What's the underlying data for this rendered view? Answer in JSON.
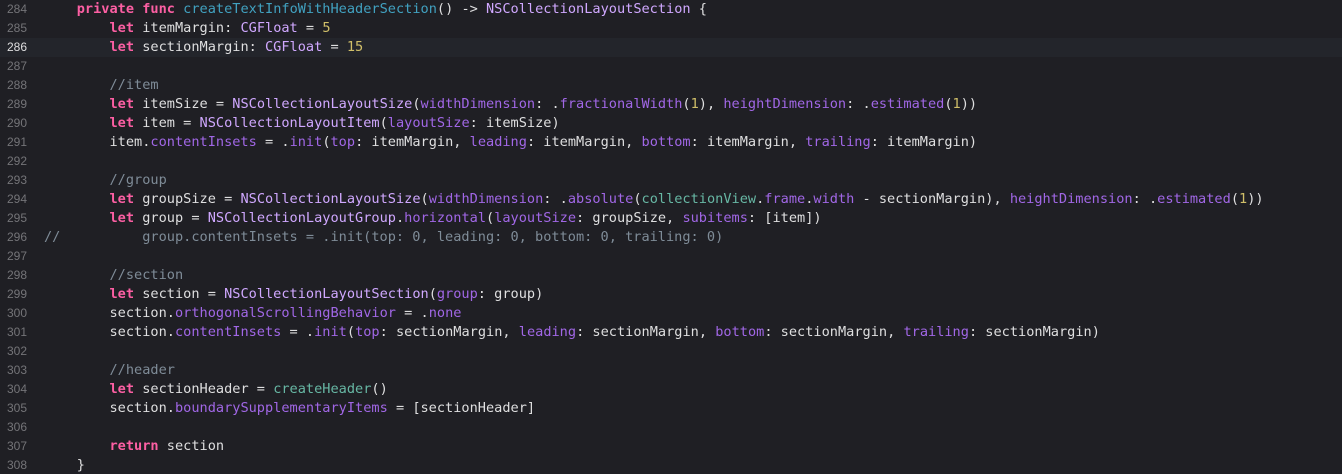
{
  "colors": {
    "background": "#1f1f24",
    "current_line": "#23252b",
    "keyword": "#fc5fa3",
    "declaration": "#41a1c0",
    "type": "#d0a8ff",
    "parameter": "#a167e6",
    "number": "#d0bf69",
    "comment": "#7f8c98",
    "project_symbol": "#67b7a4",
    "plain": "#dfdfe0"
  },
  "editor": {
    "current_line_number": "286",
    "lines": [
      {
        "num": "284",
        "tokens": [
          {
            "t": "    ",
            "c": "plain"
          },
          {
            "t": "private",
            "c": "keyword"
          },
          {
            "t": " ",
            "c": "plain"
          },
          {
            "t": "func",
            "c": "keyword"
          },
          {
            "t": " ",
            "c": "plain"
          },
          {
            "t": "createTextInfoWithHeaderSection",
            "c": "decl"
          },
          {
            "t": "() -> ",
            "c": "plain"
          },
          {
            "t": "NSCollectionLayoutSection",
            "c": "type"
          },
          {
            "t": " {",
            "c": "plain"
          }
        ]
      },
      {
        "num": "285",
        "tokens": [
          {
            "t": "        ",
            "c": "plain"
          },
          {
            "t": "let",
            "c": "keyword"
          },
          {
            "t": " itemMargin: ",
            "c": "plain"
          },
          {
            "t": "CGFloat",
            "c": "type"
          },
          {
            "t": " = ",
            "c": "plain"
          },
          {
            "t": "5",
            "c": "number"
          }
        ]
      },
      {
        "num": "286",
        "tokens": [
          {
            "t": "        ",
            "c": "plain"
          },
          {
            "t": "let",
            "c": "keyword"
          },
          {
            "t": " sectionMargin: ",
            "c": "plain"
          },
          {
            "t": "CGFloat",
            "c": "type"
          },
          {
            "t": " = ",
            "c": "plain"
          },
          {
            "t": "15",
            "c": "number"
          }
        ]
      },
      {
        "num": "287",
        "tokens": []
      },
      {
        "num": "288",
        "tokens": [
          {
            "t": "        ",
            "c": "plain"
          },
          {
            "t": "//item",
            "c": "comment"
          }
        ]
      },
      {
        "num": "289",
        "tokens": [
          {
            "t": "        ",
            "c": "plain"
          },
          {
            "t": "let",
            "c": "keyword"
          },
          {
            "t": " itemSize = ",
            "c": "plain"
          },
          {
            "t": "NSCollectionLayoutSize",
            "c": "type"
          },
          {
            "t": "(",
            "c": "plain"
          },
          {
            "t": "widthDimension",
            "c": "param"
          },
          {
            "t": ": .",
            "c": "plain"
          },
          {
            "t": "fractionalWidth",
            "c": "func"
          },
          {
            "t": "(",
            "c": "plain"
          },
          {
            "t": "1",
            "c": "number"
          },
          {
            "t": "), ",
            "c": "plain"
          },
          {
            "t": "heightDimension",
            "c": "param"
          },
          {
            "t": ": .",
            "c": "plain"
          },
          {
            "t": "estimated",
            "c": "func"
          },
          {
            "t": "(",
            "c": "plain"
          },
          {
            "t": "1",
            "c": "number"
          },
          {
            "t": "))",
            "c": "plain"
          }
        ]
      },
      {
        "num": "290",
        "tokens": [
          {
            "t": "        ",
            "c": "plain"
          },
          {
            "t": "let",
            "c": "keyword"
          },
          {
            "t": " item = ",
            "c": "plain"
          },
          {
            "t": "NSCollectionLayoutItem",
            "c": "type"
          },
          {
            "t": "(",
            "c": "plain"
          },
          {
            "t": "layoutSize",
            "c": "param"
          },
          {
            "t": ": itemSize)",
            "c": "plain"
          }
        ]
      },
      {
        "num": "291",
        "tokens": [
          {
            "t": "        ",
            "c": "plain"
          },
          {
            "t": "item.",
            "c": "plain"
          },
          {
            "t": "contentInsets",
            "c": "func"
          },
          {
            "t": " = .",
            "c": "plain"
          },
          {
            "t": "init",
            "c": "func"
          },
          {
            "t": "(",
            "c": "plain"
          },
          {
            "t": "top",
            "c": "param"
          },
          {
            "t": ": itemMargin, ",
            "c": "plain"
          },
          {
            "t": "leading",
            "c": "param"
          },
          {
            "t": ": itemMargin, ",
            "c": "plain"
          },
          {
            "t": "bottom",
            "c": "param"
          },
          {
            "t": ": itemMargin, ",
            "c": "plain"
          },
          {
            "t": "trailing",
            "c": "param"
          },
          {
            "t": ": itemMargin)",
            "c": "plain"
          }
        ]
      },
      {
        "num": "292",
        "tokens": []
      },
      {
        "num": "293",
        "tokens": [
          {
            "t": "        ",
            "c": "plain"
          },
          {
            "t": "//group",
            "c": "comment"
          }
        ]
      },
      {
        "num": "294",
        "tokens": [
          {
            "t": "        ",
            "c": "plain"
          },
          {
            "t": "let",
            "c": "keyword"
          },
          {
            "t": " groupSize = ",
            "c": "plain"
          },
          {
            "t": "NSCollectionLayoutSize",
            "c": "type"
          },
          {
            "t": "(",
            "c": "plain"
          },
          {
            "t": "widthDimension",
            "c": "param"
          },
          {
            "t": ": .",
            "c": "plain"
          },
          {
            "t": "absolute",
            "c": "func"
          },
          {
            "t": "(",
            "c": "plain"
          },
          {
            "t": "collectionView",
            "c": "project"
          },
          {
            "t": ".",
            "c": "plain"
          },
          {
            "t": "frame",
            "c": "func"
          },
          {
            "t": ".",
            "c": "plain"
          },
          {
            "t": "width",
            "c": "func"
          },
          {
            "t": " - sectionMargin), ",
            "c": "plain"
          },
          {
            "t": "heightDimension",
            "c": "param"
          },
          {
            "t": ": .",
            "c": "plain"
          },
          {
            "t": "estimated",
            "c": "func"
          },
          {
            "t": "(",
            "c": "plain"
          },
          {
            "t": "1",
            "c": "number"
          },
          {
            "t": "))",
            "c": "plain"
          }
        ]
      },
      {
        "num": "295",
        "tokens": [
          {
            "t": "        ",
            "c": "plain"
          },
          {
            "t": "let",
            "c": "keyword"
          },
          {
            "t": " group = ",
            "c": "plain"
          },
          {
            "t": "NSCollectionLayoutGroup",
            "c": "type"
          },
          {
            "t": ".",
            "c": "plain"
          },
          {
            "t": "horizontal",
            "c": "func"
          },
          {
            "t": "(",
            "c": "plain"
          },
          {
            "t": "layoutSize",
            "c": "param"
          },
          {
            "t": ": groupSize, ",
            "c": "plain"
          },
          {
            "t": "subitems",
            "c": "param"
          },
          {
            "t": ": [item])",
            "c": "plain"
          }
        ]
      },
      {
        "num": "296",
        "tokens": [
          {
            "t": "//          group.contentInsets = .init(top: 0, leading: 0, bottom: 0, trailing: 0)",
            "c": "comment"
          }
        ]
      },
      {
        "num": "297",
        "tokens": []
      },
      {
        "num": "298",
        "tokens": [
          {
            "t": "        ",
            "c": "plain"
          },
          {
            "t": "//section",
            "c": "comment"
          }
        ]
      },
      {
        "num": "299",
        "tokens": [
          {
            "t": "        ",
            "c": "plain"
          },
          {
            "t": "let",
            "c": "keyword"
          },
          {
            "t": " section = ",
            "c": "plain"
          },
          {
            "t": "NSCollectionLayoutSection",
            "c": "type"
          },
          {
            "t": "(",
            "c": "plain"
          },
          {
            "t": "group",
            "c": "param"
          },
          {
            "t": ": group)",
            "c": "plain"
          }
        ]
      },
      {
        "num": "300",
        "tokens": [
          {
            "t": "        ",
            "c": "plain"
          },
          {
            "t": "section.",
            "c": "plain"
          },
          {
            "t": "orthogonalScrollingBehavior",
            "c": "func"
          },
          {
            "t": " = .",
            "c": "plain"
          },
          {
            "t": "none",
            "c": "func"
          }
        ]
      },
      {
        "num": "301",
        "tokens": [
          {
            "t": "        ",
            "c": "plain"
          },
          {
            "t": "section.",
            "c": "plain"
          },
          {
            "t": "contentInsets",
            "c": "func"
          },
          {
            "t": " = .",
            "c": "plain"
          },
          {
            "t": "init",
            "c": "func"
          },
          {
            "t": "(",
            "c": "plain"
          },
          {
            "t": "top",
            "c": "param"
          },
          {
            "t": ": sectionMargin, ",
            "c": "plain"
          },
          {
            "t": "leading",
            "c": "param"
          },
          {
            "t": ": sectionMargin, ",
            "c": "plain"
          },
          {
            "t": "bottom",
            "c": "param"
          },
          {
            "t": ": sectionMargin, ",
            "c": "plain"
          },
          {
            "t": "trailing",
            "c": "param"
          },
          {
            "t": ": sectionMargin)",
            "c": "plain"
          }
        ]
      },
      {
        "num": "302",
        "tokens": []
      },
      {
        "num": "303",
        "tokens": [
          {
            "t": "        ",
            "c": "plain"
          },
          {
            "t": "//header",
            "c": "comment"
          }
        ]
      },
      {
        "num": "304",
        "tokens": [
          {
            "t": "        ",
            "c": "plain"
          },
          {
            "t": "let",
            "c": "keyword"
          },
          {
            "t": " sectionHeader = ",
            "c": "plain"
          },
          {
            "t": "createHeader",
            "c": "project"
          },
          {
            "t": "()",
            "c": "plain"
          }
        ]
      },
      {
        "num": "305",
        "tokens": [
          {
            "t": "        ",
            "c": "plain"
          },
          {
            "t": "section.",
            "c": "plain"
          },
          {
            "t": "boundarySupplementaryItems",
            "c": "func"
          },
          {
            "t": " = [sectionHeader]",
            "c": "plain"
          }
        ]
      },
      {
        "num": "306",
        "tokens": []
      },
      {
        "num": "307",
        "tokens": [
          {
            "t": "        ",
            "c": "plain"
          },
          {
            "t": "return",
            "c": "keyword"
          },
          {
            "t": " section",
            "c": "plain"
          }
        ]
      },
      {
        "num": "308",
        "tokens": [
          {
            "t": "    }",
            "c": "plain"
          }
        ]
      }
    ]
  }
}
